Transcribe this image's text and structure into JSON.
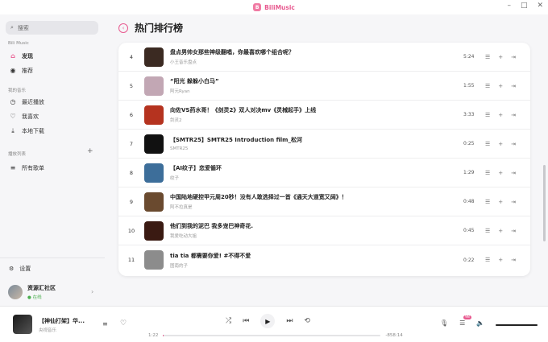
{
  "app": {
    "name": "BiliMusic",
    "logo_letter": "B"
  },
  "window_controls": {
    "minimize": "–",
    "maximize": "□",
    "close": "✕"
  },
  "sidebar": {
    "search_placeholder": "搜索",
    "section1": "Bili Music",
    "nav": [
      {
        "label": "发现",
        "icon": "home-icon",
        "active": true
      },
      {
        "label": "推荐",
        "icon": "recommend-icon",
        "active": false
      }
    ],
    "section2": "我的音乐",
    "mine": [
      {
        "label": "最近播放",
        "icon": "clock-icon"
      },
      {
        "label": "我喜欢",
        "icon": "heart-icon"
      },
      {
        "label": "本地下载",
        "icon": "download-icon"
      }
    ],
    "section3": "播放列表",
    "playlists": [
      {
        "label": "所有歌单",
        "icon": "list-icon"
      }
    ],
    "settings_label": "设置",
    "user": {
      "name": "资源汇社区",
      "status": "在线"
    }
  },
  "main": {
    "title": "热门排行榜",
    "songs": [
      {
        "rank": "4",
        "title": "盘点男帅女那些神级翻唱，你最喜欢哪个组合呢？",
        "artist": "小王音乐盘点",
        "duration": "5:24",
        "color": "#3b2a22"
      },
      {
        "rank": "5",
        "title": "“阳光 躲躲小白马”",
        "artist": "阿元Ryan",
        "duration": "1:55",
        "color": "#c2a7b4"
      },
      {
        "rank": "6",
        "title": "向佐VS药水哥！《剑灵2》双人对决mv《灵械起手》上线",
        "artist": "剑灵2",
        "duration": "3:33",
        "color": "#b5331f"
      },
      {
        "rank": "7",
        "title": "【SMTR25】SMTR25 Introduction film_松河",
        "artist": "SMTR25",
        "duration": "0:25",
        "color": "#111111"
      },
      {
        "rank": "8",
        "title": "【AI纹子】恋爱循环",
        "artist": "纹子",
        "duration": "1:29",
        "color": "#3d6e9a"
      },
      {
        "rank": "9",
        "title": "中国陆地硬控甲元周20秒！没有人敢选择过一首《通天大道宽又阔》！",
        "artist": "阿不拉真是",
        "duration": "0:48",
        "color": "#6a4a2f"
      },
      {
        "rank": "10",
        "title": "他们到我的泥巴 我多宠巴神奇花.",
        "artist": "我爱吃动大姐",
        "duration": "0:45",
        "color": "#3a1a12"
      },
      {
        "rank": "11",
        "title": "tia tia 都需要你爱! #不得不爱",
        "artist": "图南的子",
        "duration": "0:22",
        "color": "#8c8c8c"
      }
    ]
  },
  "player": {
    "title": "【神仙打架】华...",
    "artist": "央视音乐",
    "current_time": "1:22",
    "total_time": "-858:14",
    "progress_fraction": 0.003,
    "badge": "98",
    "volume_fraction": 1.0
  }
}
